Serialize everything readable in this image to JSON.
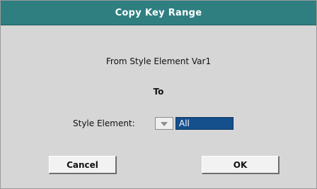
{
  "dialog": {
    "title": "Copy Key Range",
    "from_text": "From Style Element Var1",
    "to_text": "To",
    "field_label": "Style Element:",
    "field_value": "All",
    "cancel_label": "Cancel",
    "ok_label": "OK"
  },
  "colors": {
    "titlebar": "#2f7f80",
    "dialog_bg": "#d6d6d6",
    "selected_value_bg": "#154f8c"
  }
}
